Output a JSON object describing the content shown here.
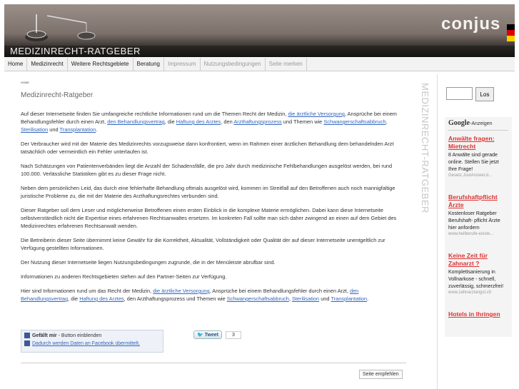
{
  "header": {
    "title": "MEDIZINRECHT-RATGEBER",
    "logo": "conjus",
    "flag_colors": [
      "#000000",
      "#dd0000",
      "#ffce00"
    ]
  },
  "nav": {
    "items": [
      {
        "label": "Home",
        "dim": false
      },
      {
        "label": "Medizinrecht",
        "dim": false
      },
      {
        "label": "Weitere Rechtsgebiete",
        "dim": false
      },
      {
        "label": "Beratung",
        "dim": false
      },
      {
        "label": "Impressum",
        "dim": true
      },
      {
        "label": "Nutzungsbedingungen",
        "dim": true
      },
      {
        "label": "Seite merken",
        "dim": true
      }
    ]
  },
  "main": {
    "breadcrumb": "HOME",
    "heading": "Medizinrecht-Ratgeber",
    "vertical_title": "MEDIZINRECHT-RATGEBER",
    "p1": {
      "t1": "Auf dieser Internetseite finden Sie umfangreiche rechtliche Informationen rund um die Themen Recht der Medizin, ",
      "l1": "die ärztliche Versorgung",
      "t2": ", Ansprüche bei einem Behandlungsfehler durch einen Arzt, ",
      "l2": "den Behandlungsvertrag",
      "t3": ", die ",
      "l3": "Haftung des Arztes",
      "t4": ", den ",
      "l4": "Arzthaftungsprozess",
      "t5": " und Themen wie ",
      "l5": "Schwangerschaftsabbruch",
      "t6": ", ",
      "l6": "Sterilisation",
      "t7": " und ",
      "l7": "Transplantation",
      "t8": "."
    },
    "p2": "Der Verbraucher wird mit der Materie des Medizinrechts vorzugsweise dann konfrontiert, wenn im Rahmen einer ärztlichen Behandlung dem behandelnden Arzt tatsächlich oder vermeintlich ein Fehler unterlaufen ist.",
    "p3": "Nach Schätzungen von Patientenverbänden liegt die Anzahl der Schadensfälle, die pro Jahr durch medizinische Fehlbehandlungen ausgelöst werden, bei rund 100.000. Verlässliche Statistiken gibt es zu dieser Frage nicht.",
    "p4": "Neben dem persönlichen Leid, das durch eine fehlerhafte Behandlung oftmals ausgelöst wird, kommen im Streitfall auf den Betroffenen auch noch mannigfaltige juristische Probleme zu, die mit der Materie des Arzthaftungsrechtes verbunden sind.",
    "p5": "Dieser Ratgeber soll dem Leser und möglicherweise Betroffenen einen ersten Einblick in die komplexe Materie ermöglichen. Dabei kann diese Internetseite selbstverständlich nicht die Expertise eines erfahrenen Rechtsanwaltes ersetzen. Im konkreten Fall sollte man sich daher zwingend an einen auf dem Gebiet des Medizinrechtes erfahrenen Rechtsanwalt wenden.",
    "p6": "Die Betreiberin dieser Seite übernimmt keine Gewähr für die Korrektheit, Aktualität, Vollständigkeit oder Qualität der auf dieser Internetseite unentgeltlich zur Verfügung gestellten Informationen.",
    "p7": "Der Nutzung dieser Internetseite liegen Nutzungsbedingungen zugrunde, die in der Menüleiste abrufbar sind.",
    "p8": "Informationen zu anderen Rechtsgebieten stehen auf den Partner-Seiten zur Verfügung.",
    "p9": {
      "t1": "Hier sind Informationen rund um das Recht der Medizin, ",
      "l1": "die ärztliche Versorgung",
      "t2": ", Ansprüche bei einem Behandlungsfehler durch einen Arzt, ",
      "l2": "den Behandlungsvertrag",
      "t3": ", die ",
      "l3": "Haftung des Arztes",
      "t4": ", den Arzthaftungsprozess und Themen wie ",
      "l5": "Schwangerschaftsabbruch",
      "t6": ", ",
      "l6": "Sterilisation",
      "t7": " und ",
      "l7": "Transplantation",
      "t8": "."
    }
  },
  "social": {
    "like_bold": "Gefällt mir",
    "like_rest": " - Button einblenden",
    "facebook_link": "Dadurch werden Daten an Facebook übermittelt.",
    "tweet_label": "Tweet",
    "tweet_count": "3",
    "recommend": "Seite empfehlen"
  },
  "sidebar": {
    "search_button": "Los",
    "ads_label_brand": "Google",
    "ads_label": "-Anzeigen",
    "ads": [
      {
        "title": "Anwälte fragen: Mietrecht",
        "desc": "8 Anwälte sind gerade online. Stellen Sie jetzt Ihre Frage!",
        "url": "Gesetz.JustAnswer.d..."
      },
      {
        "title": "Berufshaftpflicht Ärzte",
        "desc": "Kostenloser Ratgeber Berufshaft- pflicht Ärzte hier anfordern",
        "url": "www.heilberufe-existe..."
      },
      {
        "title": "Keine Zeit für Zahnarzt ?",
        "desc": "Komplettsanierung in Vollnarkose - schnell, zuverlässig, schmerzfrei!",
        "url": "www.zahnarztangst.ch"
      },
      {
        "title": "Hotels in Ihringen",
        "desc": "",
        "url": ""
      }
    ]
  }
}
